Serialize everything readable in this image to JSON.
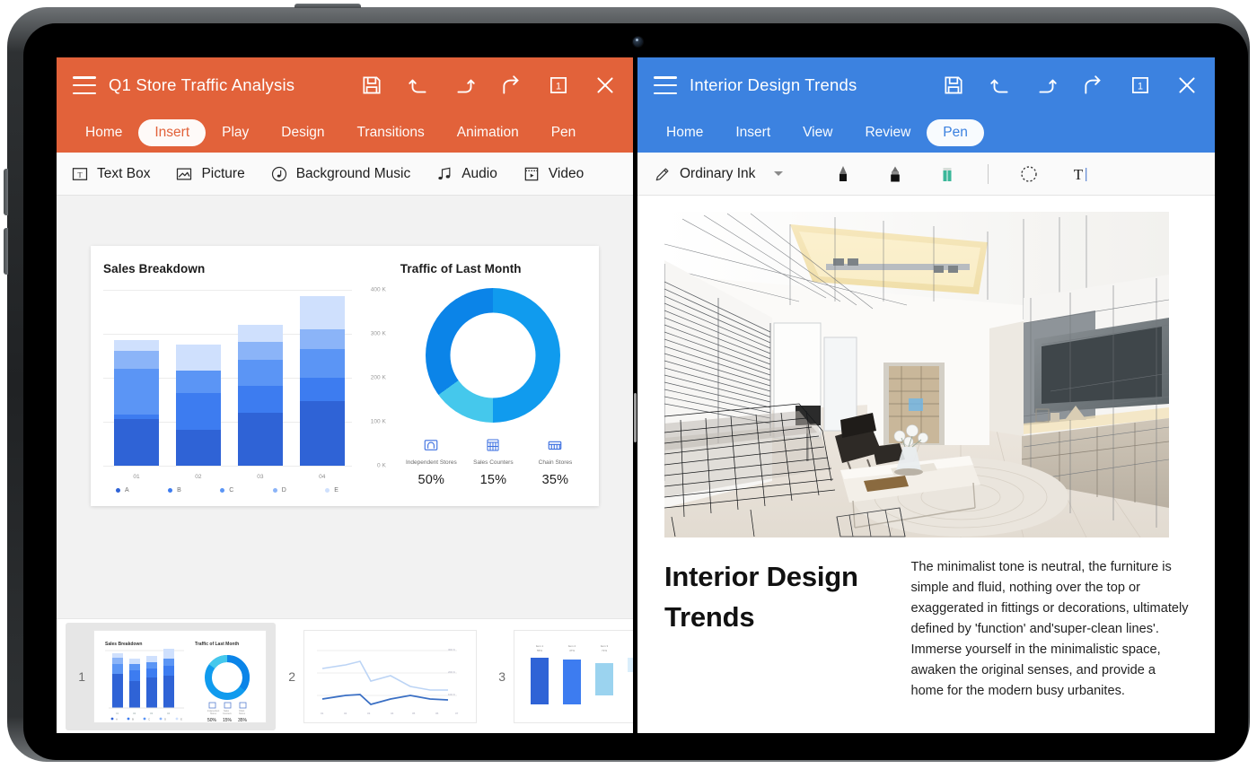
{
  "left_app": {
    "doc_title": "Q1 Store Traffic Analysis",
    "header_color": "#e2623a",
    "menu_icon": "hamburger-icon",
    "actions": [
      {
        "name": "save-icon",
        "label": "Save"
      },
      {
        "name": "undo-icon",
        "label": "Undo"
      },
      {
        "name": "redo-icon",
        "label": "Redo"
      },
      {
        "name": "share-icon",
        "label": "Share"
      },
      {
        "name": "page-count-icon",
        "label": "1"
      },
      {
        "name": "close-icon",
        "label": "Close"
      }
    ],
    "page_badge": "1",
    "tabs": [
      {
        "label": "Home",
        "active": false
      },
      {
        "label": "Insert",
        "active": true
      },
      {
        "label": "Play",
        "active": false
      },
      {
        "label": "Design",
        "active": false
      },
      {
        "label": "Transitions",
        "active": false
      },
      {
        "label": "Animation",
        "active": false
      },
      {
        "label": "Pen",
        "active": false
      }
    ],
    "ribbon": [
      {
        "label": "Text Box",
        "icon": "text-box-icon"
      },
      {
        "label": "Picture",
        "icon": "picture-icon"
      },
      {
        "label": "Background Music",
        "icon": "music-note-circle-icon"
      },
      {
        "label": "Audio",
        "icon": "audio-icon"
      },
      {
        "label": "Video",
        "icon": "video-icon"
      }
    ],
    "thumbnails": [
      {
        "number": "1",
        "selected": true
      },
      {
        "number": "2",
        "selected": false
      },
      {
        "number": "3",
        "selected": false
      }
    ]
  },
  "right_app": {
    "doc_title": "Interior Design Trends",
    "header_color": "#3c82e0",
    "menu_icon": "hamburger-icon",
    "page_badge": "1",
    "tabs": [
      {
        "label": "Home",
        "active": false
      },
      {
        "label": "Insert",
        "active": false
      },
      {
        "label": "View",
        "active": false
      },
      {
        "label": "Review",
        "active": false
      },
      {
        "label": "Pen",
        "active": true
      }
    ],
    "pen_bar": {
      "pen_label": "Ordinary Ink",
      "pen_icon": "pencil-icon",
      "dropdown_icon": "caret-down-icon",
      "tools": [
        {
          "name": "pencil-tool-icon"
        },
        {
          "name": "marker-tool-icon"
        },
        {
          "name": "eraser-tool-icon"
        },
        {
          "name": "lasso-select-icon"
        },
        {
          "name": "text-tool-icon"
        }
      ]
    },
    "slide": {
      "image_alt": "interior-living-room-wireframe-render",
      "title": "Interior Design Trends",
      "body": "The minimalist tone is neutral, the furniture is simple and fluid, nothing over the top or exaggerated in fittings or decorations, ultimately defined by 'function' and'super-clean lines'. Immerse yourself in the minimalistic space, awaken the original senses, and provide a home for the modern busy urbanites."
    }
  },
  "chart_data": [
    {
      "type": "bar",
      "title": "Sales Breakdown",
      "stacked": true,
      "categories": [
        "01",
        "02",
        "03",
        "04"
      ],
      "series": [
        {
          "name": "A",
          "color": "#2f63d6",
          "values": [
            105000,
            80000,
            120000,
            145000
          ]
        },
        {
          "name": "B",
          "color": "#3d7cf0",
          "values": [
            10000,
            85000,
            60000,
            55000
          ]
        },
        {
          "name": "C",
          "color": "#5b95f5",
          "values": [
            105000,
            50000,
            60000,
            65000
          ]
        },
        {
          "name": "D",
          "color": "#8bb4f8",
          "values": [
            40000,
            0,
            40000,
            45000
          ]
        },
        {
          "name": "E",
          "color": "#cfe0fd",
          "values": [
            25000,
            60000,
            40000,
            75000
          ]
        }
      ],
      "xlabel": "",
      "ylabel": "",
      "ytick_labels": [
        "0 K",
        "100 K",
        "200 K",
        "300 K",
        "400 K"
      ],
      "ylim": [
        0,
        400000
      ],
      "grid": true,
      "legend_position": "bottom"
    },
    {
      "type": "pie",
      "title": "Traffic of Last Month",
      "donut": true,
      "labels": [
        "Independent Stores",
        "Sales Counters",
        "Chain Stores"
      ],
      "values": [
        50,
        15,
        35
      ],
      "value_labels": [
        "50%",
        "15%",
        "35%"
      ],
      "colors": [
        "#109bee",
        "#45c8ec",
        "#0b84e8"
      ],
      "icons": [
        "independent-store-icon",
        "sales-counter-icon",
        "chain-store-icon"
      ],
      "legend_position": "bottom"
    }
  ]
}
